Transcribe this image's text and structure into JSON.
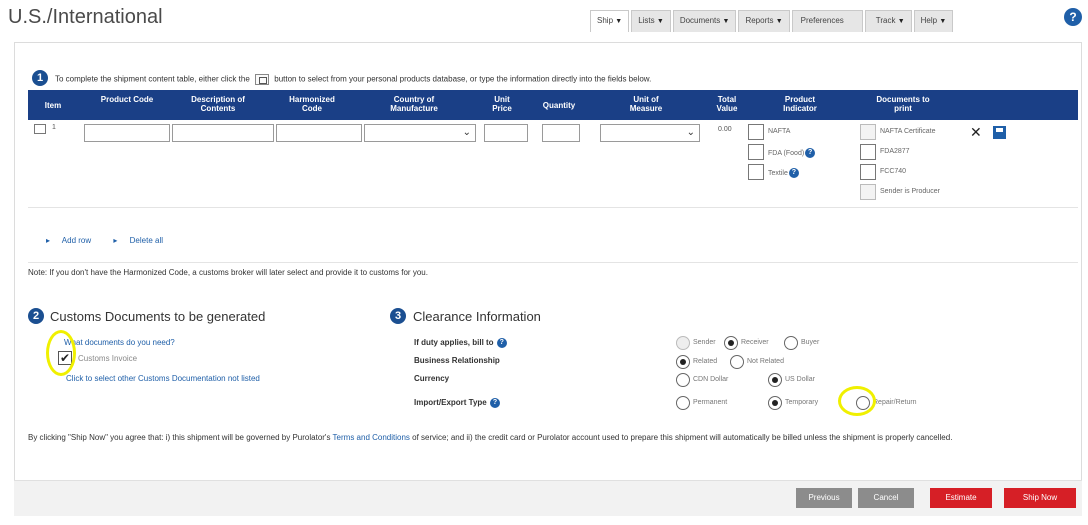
{
  "header": {
    "title": "U.S./International",
    "tabs": [
      {
        "label": "Ship",
        "caret": "▼"
      },
      {
        "label": "Lists",
        "caret": "▼"
      },
      {
        "label": "Documents",
        "caret": "▼"
      },
      {
        "label": "Reports",
        "caret": "▼"
      },
      {
        "label": "Preferences",
        "caret": ""
      },
      {
        "label": "Track",
        "caret": "▼"
      },
      {
        "label": "Help",
        "caret": "▼"
      }
    ],
    "help_icon": "?"
  },
  "step1": {
    "number": "1",
    "instruction_before": "To complete the shipment content table, either click the",
    "instruction_after": "button to select from your personal products database, or type the information directly into the fields below."
  },
  "table": {
    "headers": [
      "Item",
      "Product Code",
      "Description of Contents",
      "Harmonized Code",
      "Country of Manufacture",
      "Unit Price",
      "Quantity",
      "Unit of Measure",
      "Total Value",
      "Product Indicator",
      "Documents to print"
    ],
    "row": {
      "item": "1",
      "total_value": "0.00",
      "product_indicators": [
        "NAFTA",
        "FDA (Food)",
        "Textile"
      ],
      "documents": [
        "NAFTA Certificate",
        "FDA2877",
        "FCC740",
        "Sender is Producer"
      ]
    },
    "add_row": "Add row",
    "delete_all": "Delete all",
    "link_marker": "▸"
  },
  "note": "Note: If you don't have the Harmonized Code, a customs broker will later select and provide it to customs for you.",
  "step2": {
    "number": "2",
    "title": "Customs Documents to be generated",
    "what_docs_link": "What documents do you need?",
    "customs_invoice": "Customs Invoice",
    "customs_invoice_checked": true,
    "other_docs_link": "Click to select other Customs Documentation not listed"
  },
  "step3": {
    "number": "3",
    "title": "Clearance Information",
    "rows": [
      {
        "label": "If duty applies, bill to",
        "options": [
          "Sender",
          "Receiver",
          "Buyer"
        ],
        "selected": "Receiver"
      },
      {
        "label": "Business Relationship",
        "options": [
          "Related",
          "Not Related"
        ],
        "selected": "Related"
      },
      {
        "label": "Currency",
        "options": [
          "CDN Dollar",
          "US Dollar"
        ],
        "selected": "US Dollar"
      },
      {
        "label": "Import/Export Type",
        "options": [
          "Permanent",
          "Temporary",
          "Repair/Return"
        ],
        "selected": "Temporary"
      }
    ]
  },
  "agreement": {
    "text_before": "By clicking \"Ship Now\" you agree that: i) this shipment will be governed by Purolator's",
    "terms_link": "Terms and Conditions",
    "text_after": "of service; and ii) the credit card or Purolator account used to prepare this shipment will automatically be billed unless the shipment is properly cancelled."
  },
  "buttons": {
    "previous": "Previous",
    "cancel": "Cancel",
    "estimate": "Estimate",
    "ship_now": "Ship Now"
  }
}
